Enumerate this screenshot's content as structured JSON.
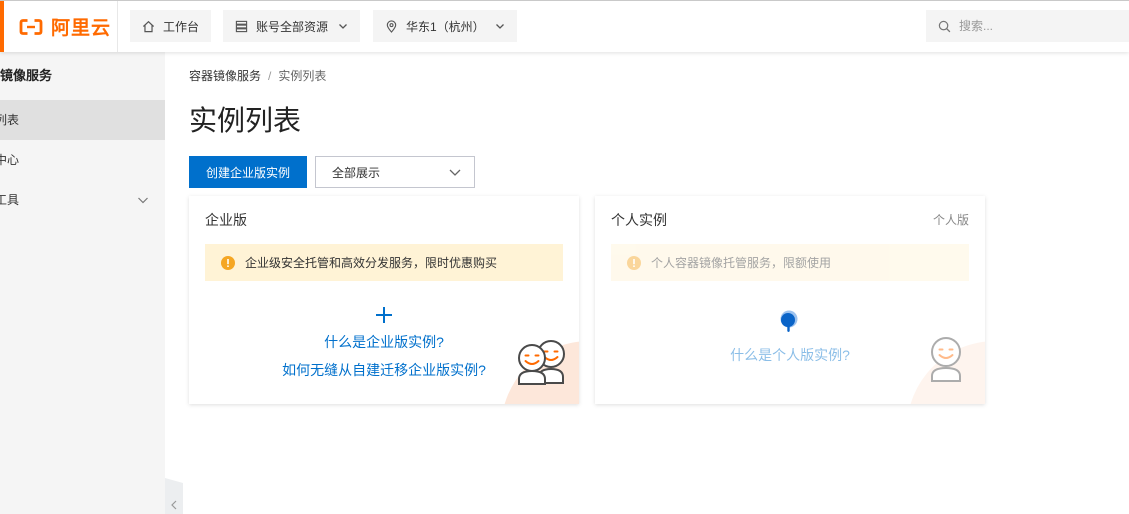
{
  "topbar": {
    "logo": {
      "icon": "aliyun-logo-icon",
      "text": "阿里云"
    },
    "workbench": {
      "label": "工作台",
      "icon": "home-icon"
    },
    "resources": {
      "label": "账号全部资源",
      "icon": "list-icon"
    },
    "region": {
      "label": "华东1（杭州）",
      "icon": "location-icon"
    },
    "search": {
      "placeholder": "搜索...",
      "icon": "search-icon"
    }
  },
  "sidebar": {
    "title": "镜像服务",
    "items": [
      {
        "label": "列表",
        "active": true
      },
      {
        "label": "中心",
        "active": false
      },
      {
        "label": "工具",
        "active": false,
        "expandable": true
      }
    ]
  },
  "breadcrumb": {
    "root": "容器镜像服务",
    "separator": "/",
    "current": "实例列表"
  },
  "page": {
    "title": "实例列表"
  },
  "toolbar": {
    "create_button": "创建企业版实例",
    "filter": {
      "selected": "全部展示"
    }
  },
  "cards": {
    "enterprise": {
      "title": "企业版",
      "notice": "企业级安全托管和高效分发服务，限时优惠购买",
      "add_icon": "plus-icon",
      "links": [
        "什么是企业版实例?",
        "如何无缝从自建迁移企业版实例?"
      ]
    },
    "personal": {
      "title": "个人实例",
      "tag": "个人版",
      "notice": "个人容器镜像托管服务，限额使用",
      "status_icon": "loading-icon",
      "link": "什么是个人版实例?"
    }
  },
  "colors": {
    "brand": "#ff6a00",
    "primary": "#0070cc",
    "notice_bg": "#fff3d6",
    "notice_icon": "#f5a623",
    "sidebar_bg": "#f5f5f5",
    "sidebar_active": "#e0e0e0"
  }
}
